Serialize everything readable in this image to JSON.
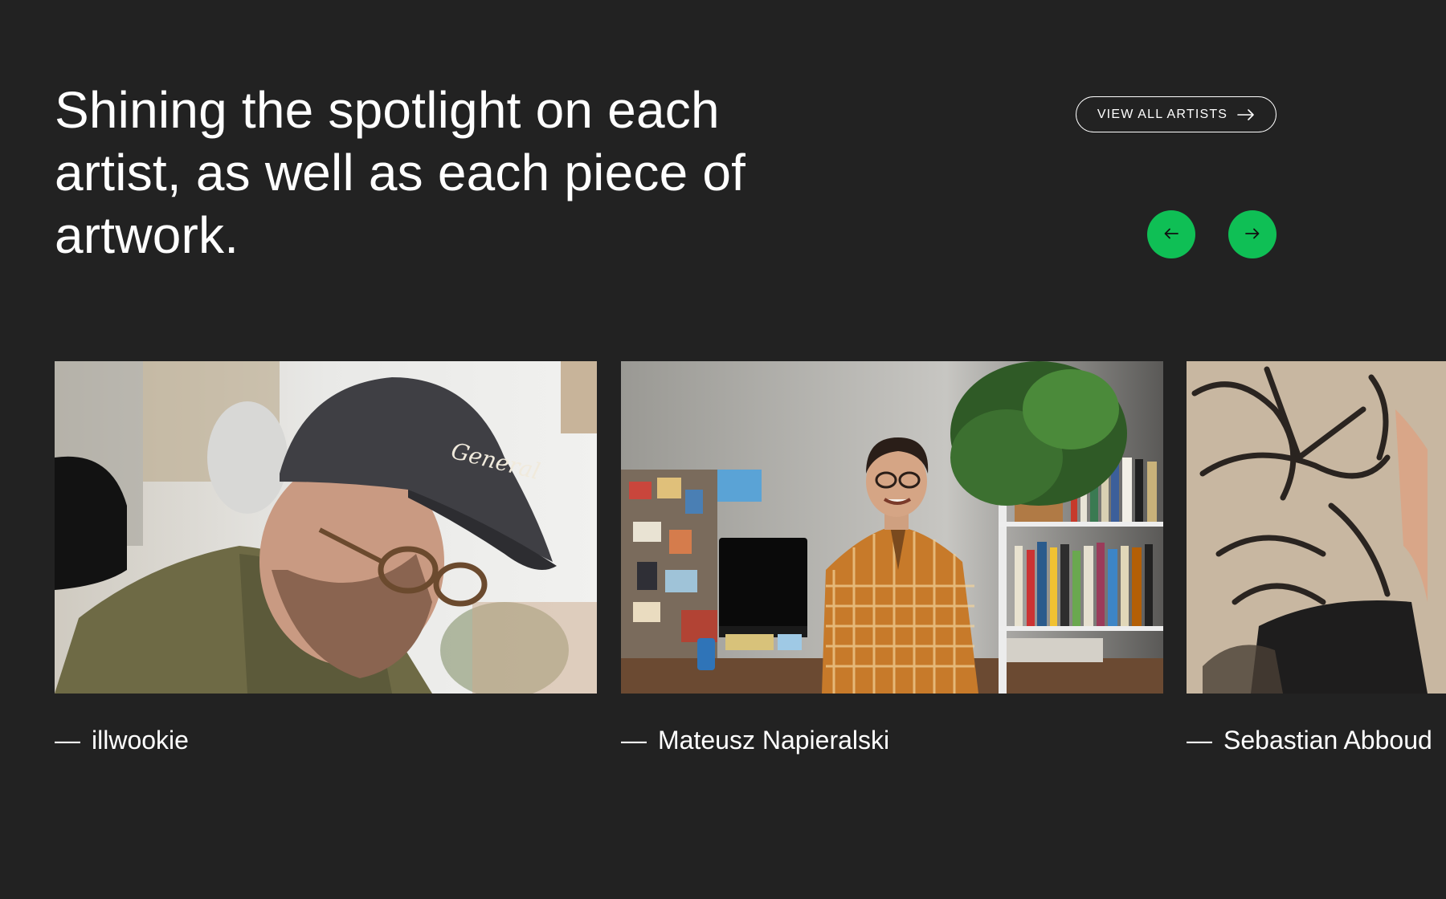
{
  "hero": {
    "headline": "Shining the spotlight on each artist, as well as each piece of artwork."
  },
  "actions": {
    "view_all_label": "VIEW ALL ARTISTS",
    "prev_icon": "arrow-left-icon",
    "next_icon": "arrow-right-icon"
  },
  "colors": {
    "background": "#222222",
    "accent": "#0fbf55",
    "text": "#ffffff"
  },
  "artists": [
    {
      "dash": "—",
      "name": "illwookie"
    },
    {
      "dash": "—",
      "name": "Mateusz Napieralski"
    },
    {
      "dash": "—",
      "name": "Sebastian Abboud"
    }
  ]
}
